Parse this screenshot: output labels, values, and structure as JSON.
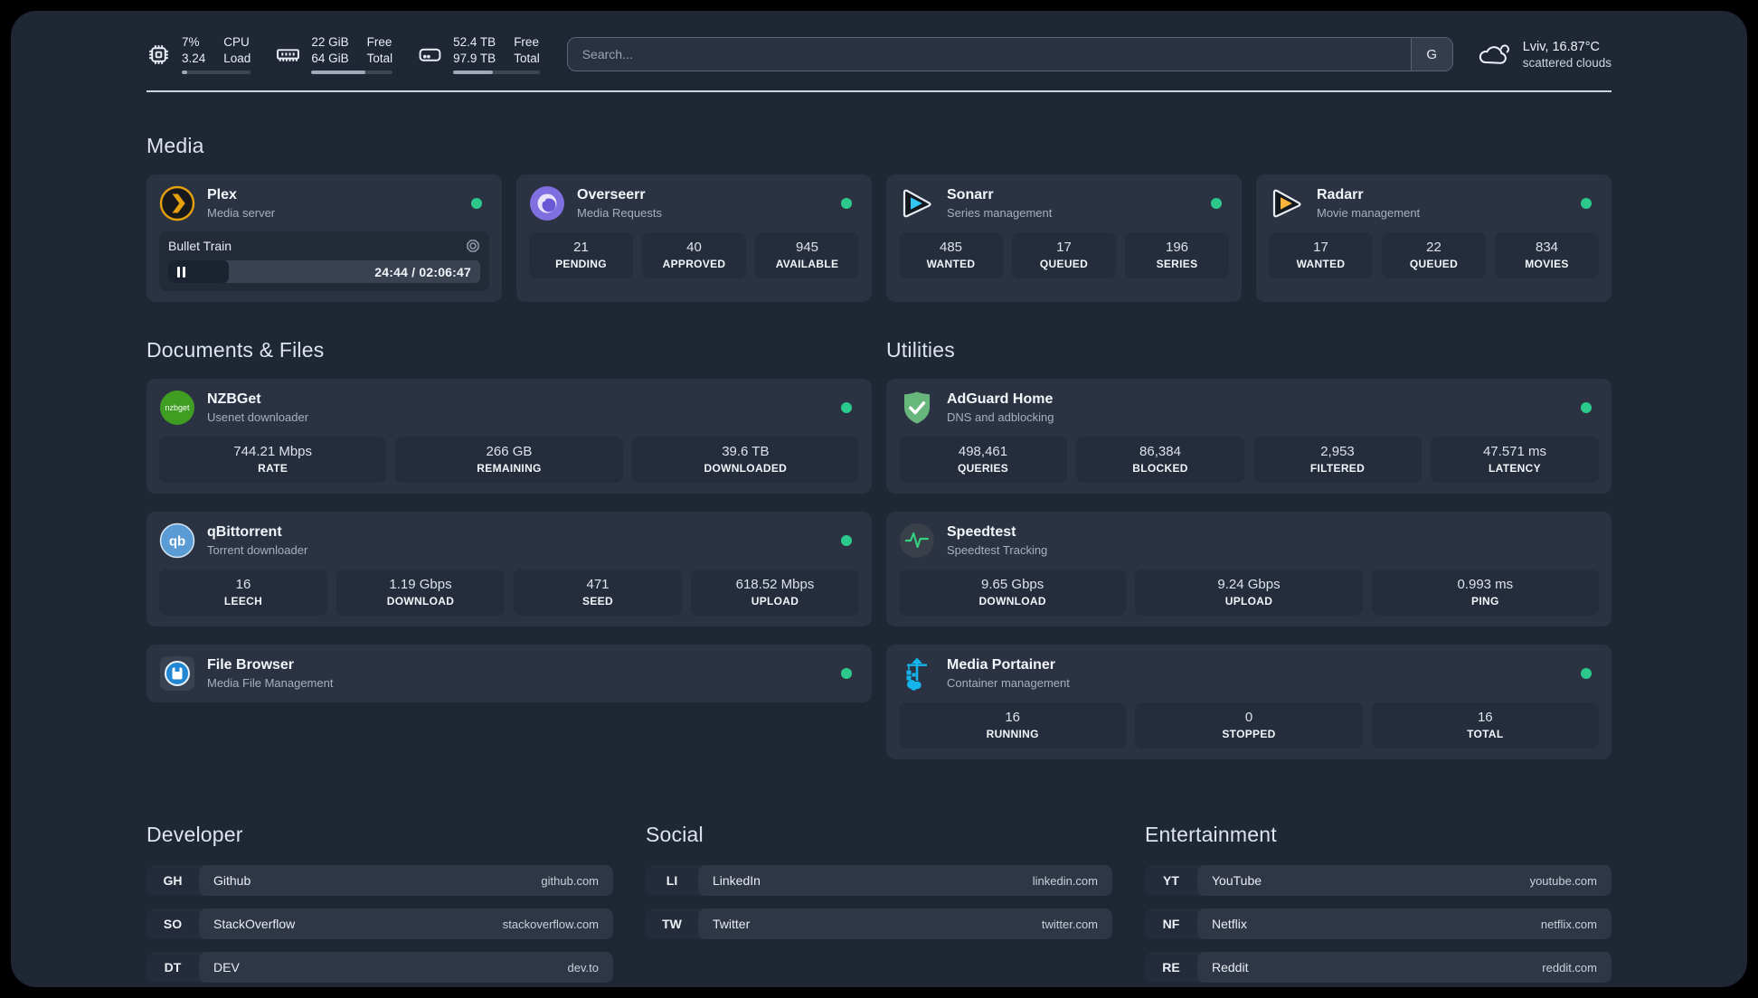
{
  "colors": {
    "status_online": "#2bc98c",
    "plex": "#e5a00d",
    "overseerr": "#7f6fe0",
    "sonarr": "#35c5f4",
    "radarr": "#ffb63a",
    "nzbget": "#3f9e22",
    "qbittorrent": "#5b9bd5",
    "filebrowser": "#2286d3",
    "adguard": "#67b77c",
    "speedtest": "#35d07f",
    "portainer": "#13b5ea"
  },
  "topbar": {
    "metrics": [
      {
        "name": "cpu",
        "values": [
          "7%",
          "3.24"
        ],
        "labels": [
          "CPU",
          "Load"
        ],
        "progress": 8
      },
      {
        "name": "memory",
        "values": [
          "22 GiB",
          "64 GiB"
        ],
        "labels": [
          "Free",
          "Total"
        ],
        "progress": 66
      },
      {
        "name": "disk",
        "values": [
          "52.4 TB",
          "97.9 TB"
        ],
        "labels": [
          "Free",
          "Total"
        ],
        "progress": 46
      }
    ],
    "search": {
      "placeholder": "Search...",
      "button_label": "G"
    },
    "weather": {
      "location": "Lviv, 16.87°C",
      "condition": "scattered clouds"
    }
  },
  "media": {
    "title": "Media",
    "plex": {
      "title": "Plex",
      "subtitle": "Media server",
      "player": {
        "track": "Bullet Train",
        "time": "24:44 / 02:06:47",
        "progress": 19.5
      }
    },
    "overseerr": {
      "title": "Overseerr",
      "subtitle": "Media Requests",
      "stats": [
        {
          "value": "21",
          "label": "PENDING"
        },
        {
          "value": "40",
          "label": "APPROVED"
        },
        {
          "value": "945",
          "label": "AVAILABLE"
        }
      ]
    },
    "sonarr": {
      "title": "Sonarr",
      "subtitle": "Series management",
      "stats": [
        {
          "value": "485",
          "label": "WANTED"
        },
        {
          "value": "17",
          "label": "QUEUED"
        },
        {
          "value": "196",
          "label": "SERIES"
        }
      ]
    },
    "radarr": {
      "title": "Radarr",
      "subtitle": "Movie management",
      "stats": [
        {
          "value": "17",
          "label": "WANTED"
        },
        {
          "value": "22",
          "label": "QUEUED"
        },
        {
          "value": "834",
          "label": "MOVIES"
        }
      ]
    }
  },
  "documents": {
    "title": "Documents & Files",
    "nzbget": {
      "title": "NZBGet",
      "subtitle": "Usenet downloader",
      "icon_label": "nzbget",
      "stats": [
        {
          "value": "744.21 Mbps",
          "label": "RATE"
        },
        {
          "value": "266 GB",
          "label": "REMAINING"
        },
        {
          "value": "39.6 TB",
          "label": "DOWNLOADED"
        }
      ]
    },
    "qbittorrent": {
      "title": "qBittorrent",
      "subtitle": "Torrent downloader",
      "icon_label": "qb",
      "stats": [
        {
          "value": "16",
          "label": "LEECH"
        },
        {
          "value": "1.19 Gbps",
          "label": "DOWNLOAD"
        },
        {
          "value": "471",
          "label": "SEED"
        },
        {
          "value": "618.52 Mbps",
          "label": "UPLOAD"
        }
      ]
    },
    "filebrowser": {
      "title": "File Browser",
      "subtitle": "Media File Management"
    }
  },
  "utilities": {
    "title": "Utilities",
    "adguard": {
      "title": "AdGuard Home",
      "subtitle": "DNS and adblocking",
      "stats": [
        {
          "value": "498,461",
          "label": "QUERIES"
        },
        {
          "value": "86,384",
          "label": "BLOCKED"
        },
        {
          "value": "2,953",
          "label": "FILTERED"
        },
        {
          "value": "47.571 ms",
          "label": "LATENCY"
        }
      ]
    },
    "speedtest": {
      "title": "Speedtest",
      "subtitle": "Speedtest Tracking",
      "stats": [
        {
          "value": "9.65 Gbps",
          "label": "DOWNLOAD"
        },
        {
          "value": "9.24 Gbps",
          "label": "UPLOAD"
        },
        {
          "value": "0.993 ms",
          "label": "PING"
        }
      ]
    },
    "portainer": {
      "title": "Media Portainer",
      "subtitle": "Container management",
      "stats": [
        {
          "value": "16",
          "label": "RUNNING"
        },
        {
          "value": "0",
          "label": "STOPPED"
        },
        {
          "value": "16",
          "label": "TOTAL"
        }
      ]
    }
  },
  "links": {
    "developer": {
      "title": "Developer",
      "items": [
        {
          "abbr": "GH",
          "name": "Github",
          "url": "github.com"
        },
        {
          "abbr": "SO",
          "name": "StackOverflow",
          "url": "stackoverflow.com"
        },
        {
          "abbr": "DT",
          "name": "DEV",
          "url": "dev.to"
        }
      ]
    },
    "social": {
      "title": "Social",
      "items": [
        {
          "abbr": "LI",
          "name": "LinkedIn",
          "url": "linkedin.com"
        },
        {
          "abbr": "TW",
          "name": "Twitter",
          "url": "twitter.com"
        }
      ]
    },
    "entertainment": {
      "title": "Entertainment",
      "items": [
        {
          "abbr": "YT",
          "name": "YouTube",
          "url": "youtube.com"
        },
        {
          "abbr": "NF",
          "name": "Netflix",
          "url": "netflix.com"
        },
        {
          "abbr": "RE",
          "name": "Reddit",
          "url": "reddit.com"
        }
      ]
    }
  }
}
